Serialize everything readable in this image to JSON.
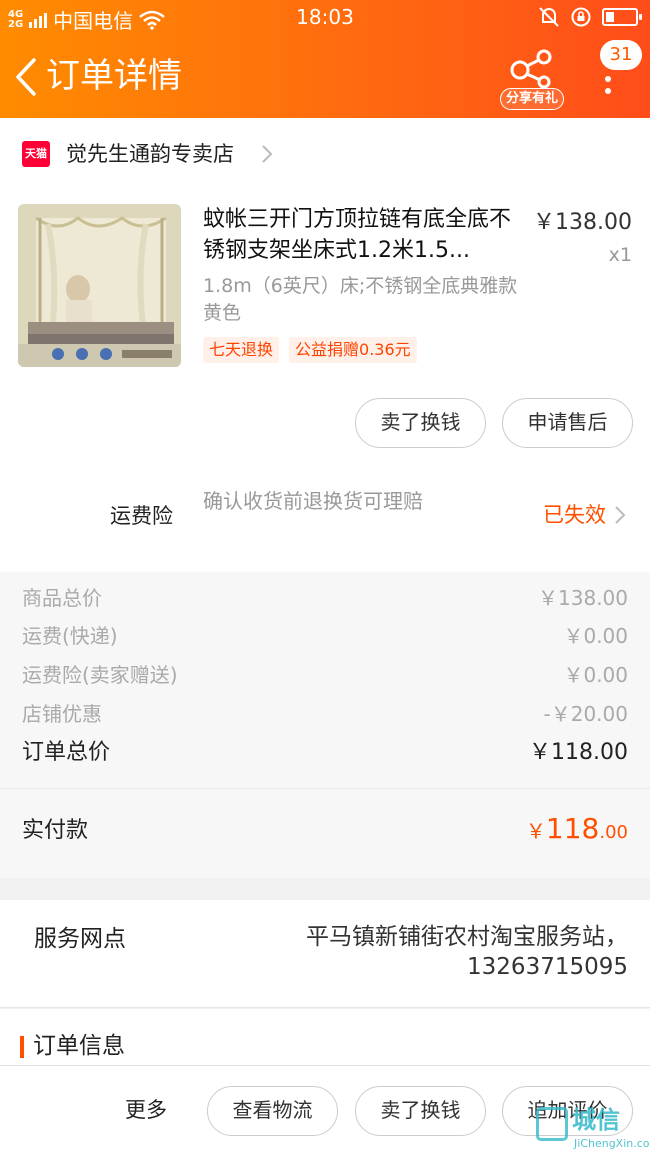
{
  "status_bar": {
    "network": "4G",
    "network2": "2G",
    "carrier": "中国电信",
    "time": "18:03"
  },
  "nav": {
    "title": "订单详情",
    "share_label": "分享有礼",
    "badge_count": "31"
  },
  "shop": {
    "badge": "天猫",
    "name": "觉先生通韵专卖店"
  },
  "product": {
    "title": "蚊帐三开门方顶拉链有底全底不锈钢支架坐床式1.2米1.5...",
    "price": "￥138.00",
    "qty": "x1",
    "sku": "1.8m（6英尺）床;不锈钢全底典雅款黄色",
    "tags": [
      "七天退换",
      "公益捐赠0.36元"
    ],
    "actions": [
      "卖了换钱",
      "申请售后"
    ]
  },
  "insurance": {
    "label": "运费险",
    "desc": "确认收货前退换货可理赔",
    "status": "已失效"
  },
  "summary": {
    "rows": [
      {
        "label": "商品总价",
        "value": "￥138.00"
      },
      {
        "label": "运费(快递)",
        "value": "￥0.00"
      },
      {
        "label": "运费险(卖家赠送)",
        "value": "￥0.00"
      },
      {
        "label": "店铺优惠",
        "value": "-￥20.00"
      }
    ],
    "total_label": "订单总价",
    "total_value": "￥118.00"
  },
  "paid": {
    "label": "实付款",
    "symbol": "￥",
    "int": "118",
    "dec": ".00"
  },
  "service": {
    "label": "服务网点",
    "value": "平马镇新铺街农村淘宝服务站，13263715095"
  },
  "order_info": {
    "title": "订单信息"
  },
  "footer": {
    "more_label": "更多",
    "buttons": [
      "查看物流",
      "卖了换钱",
      "追加评价"
    ]
  },
  "watermark": {
    "cn": "城信",
    "en": "JiChengXin.com"
  },
  "colors": {
    "accent": "#ff5000",
    "header_start": "#ff8c00",
    "header_end": "#ff4d1a",
    "tmall_red": "#ff0036"
  }
}
